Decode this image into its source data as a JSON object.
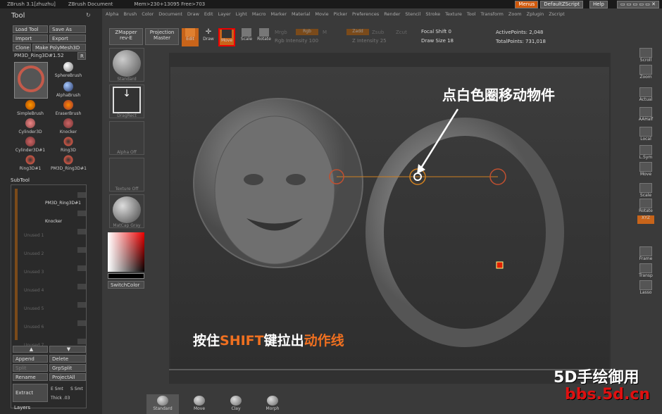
{
  "titlebar": {
    "app": "ZBrush 3.1[zhuzhu]",
    "doc": "ZBrush Document",
    "mem": "Mem>230+13095 Free>703",
    "menus": "Menus",
    "script": "DefaultZScript",
    "help": "Help"
  },
  "menus": [
    "Alpha",
    "Brush",
    "Color",
    "Document",
    "Draw",
    "Edit",
    "Layer",
    "Light",
    "Macro",
    "Marker",
    "Material",
    "Movie",
    "Picker",
    "Preferences",
    "Render",
    "Stencil",
    "Stroke",
    "Texture",
    "Tool",
    "Transform",
    "Zoom",
    "Zplugin",
    "Zscript"
  ],
  "tool": {
    "title": "Tool",
    "load": "Load Tool",
    "save": "Save As",
    "import": "Import",
    "export": "Export",
    "clone": "Clone",
    "make": "Make PolyMesh3D",
    "current": "PM3D_Ring3D#1.52",
    "r": "R",
    "thumb_label": "PM3D_Ring3D#1",
    "items": [
      "SphereBrush",
      "AlphaBrush",
      "SimpleBrush",
      "EraserBrush",
      "Cylinder3D",
      "Knocker",
      "Cylinder3D#1",
      "Ring3D",
      "Ring3D#1",
      "PM3D_Ring3D#1"
    ]
  },
  "subtool": {
    "title": "SubTool",
    "items": [
      "PM3D_Ring3D#1",
      "Knocker",
      "Unused 1",
      "Unused 2",
      "Unused 3",
      "Unused 4",
      "Unused 5",
      "Unused 6",
      "Unused 7"
    ],
    "append": "Append",
    "delete": "Delete",
    "split": "Split",
    "grpsplit": "GrpSplit",
    "rename": "Rename",
    "projectall": "ProjectAll",
    "extract": "Extract",
    "esmt": "E Smt",
    "ssmt": "S Smt",
    "thick": "Thick .03",
    "layers": "Layers"
  },
  "top": {
    "zmapper": "ZMapper",
    "rev": "rev-E",
    "projection": "Projection",
    "master": "Master",
    "edit": "Edit",
    "draw": "Draw",
    "move": "Move",
    "scale": "Scale",
    "rotate": "Rotate",
    "mrgb": "Mrgb",
    "rgb": "Rgb",
    "m": "M",
    "zadd": "Zadd",
    "zsub": "Zsub",
    "zcut": "Zcut",
    "rgb_int": "Rgb Intensity 100",
    "z_int": "Z Intensity 25",
    "focal": "Focal Shift 0",
    "drawsize": "Draw Size 18",
    "activepoints": "ActivePoints: 2,048",
    "totalpoints": "TotalPoints: 731,018"
  },
  "left": {
    "standard": "Standard",
    "dragrect": "DragRect",
    "alpha": "Alpha Off",
    "texture": "Texture Off",
    "matcap": "MatCap Gray",
    "switch": "SwitchColor"
  },
  "right": [
    "Scroll",
    "Zoom",
    "Actual",
    "AAHalf",
    "Local",
    "L.Sym",
    "Move",
    "Scale",
    "Rotate",
    "XYZ",
    "Frame",
    "Transp",
    "Lasso"
  ],
  "bottom": [
    "Standard",
    "Move",
    "Clay",
    "Morph"
  ],
  "annot": {
    "top": "点白色圈移动物件",
    "bottom_a": "按住",
    "bottom_b": "SHIFT",
    "bottom_c": "键拉出",
    "bottom_d": "动作线",
    "wm1": "5D手绘御用",
    "wm2": "bbs.5d.cn"
  }
}
